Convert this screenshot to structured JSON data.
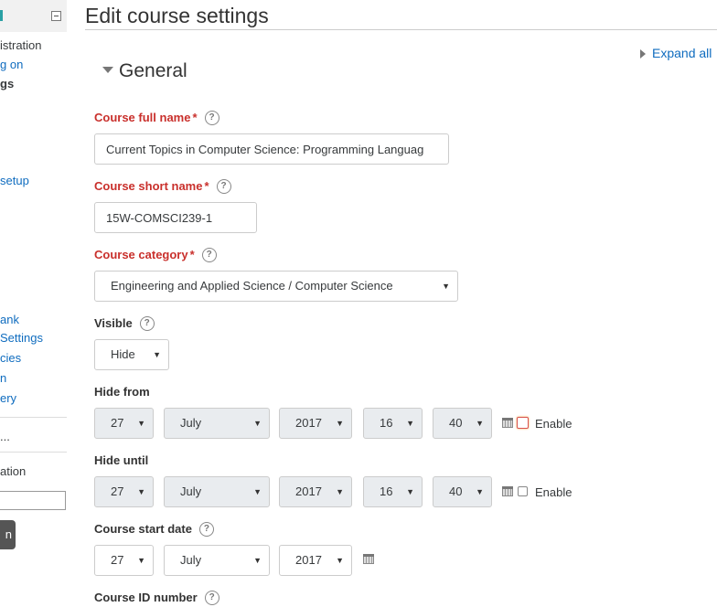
{
  "sidebar": {
    "items": [
      {
        "label": "istration",
        "kind": "link"
      },
      {
        "label": "g on",
        "kind": "link"
      },
      {
        "label": "gs",
        "kind": "bold"
      },
      {
        "label": " setup",
        "kind": "link"
      },
      {
        "label": "ank",
        "kind": "link"
      },
      {
        "label": "Settings",
        "kind": "link"
      },
      {
        "label": "cies",
        "kind": "link"
      },
      {
        "label": "n",
        "kind": "link"
      },
      {
        "label": "ery",
        "kind": "link"
      }
    ],
    "more": "...",
    "search_heading": "ation",
    "go_label": "n"
  },
  "page": {
    "title": "Edit course settings",
    "expand_all": "Expand all",
    "section": "General"
  },
  "form": {
    "full_name": {
      "label": "Course full name",
      "value": "Current Topics in Computer Science: Programming Languag"
    },
    "short_name": {
      "label": "Course short name",
      "value": "15W-COMSCI239-1"
    },
    "category": {
      "label": "Course category",
      "value": "Engineering and Applied Science / Computer Science"
    },
    "visible": {
      "label": "Visible",
      "value": "Hide"
    },
    "hide_from": {
      "label": "Hide from",
      "day": "27",
      "month": "July",
      "year": "2017",
      "hour": "16",
      "minute": "40",
      "enable": "Enable"
    },
    "hide_until": {
      "label": "Hide until",
      "day": "27",
      "month": "July",
      "year": "2017",
      "hour": "16",
      "minute": "40",
      "enable": "Enable"
    },
    "start_date": {
      "label": "Course start date",
      "day": "27",
      "month": "July",
      "year": "2017"
    },
    "id_number": {
      "label": "Course ID number"
    }
  },
  "symbols": {
    "required": "*",
    "help": "?",
    "dropdown": "▼"
  },
  "colors": {
    "link": "#0f6cbf",
    "required": "#c9302c",
    "disabled_bg": "#e9ecef"
  }
}
